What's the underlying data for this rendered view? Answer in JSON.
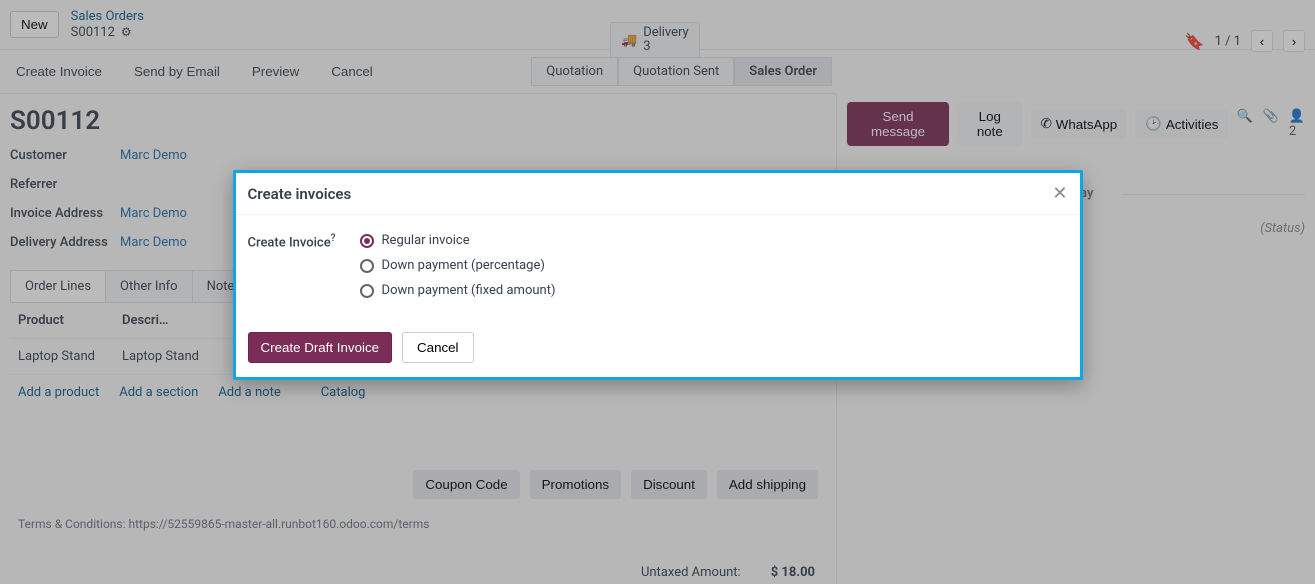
{
  "header": {
    "new_label": "New",
    "breadcrumb_parent": "Sales Orders",
    "breadcrumb_current": "S00112",
    "delivery_label": "Delivery",
    "delivery_count": "3",
    "pager_text": "1 / 1"
  },
  "actions": {
    "create_invoice": "Create Invoice",
    "send_email": "Send by Email",
    "preview": "Preview",
    "cancel": "Cancel"
  },
  "status": {
    "quotation": "Quotation",
    "quotation_sent": "Quotation Sent",
    "sales_order": "Sales Order"
  },
  "doc": {
    "title": "S00112",
    "customer_label": "Customer",
    "customer_value": "Marc Demo",
    "referrer_label": "Referrer",
    "invoice_addr_label": "Invoice Address",
    "invoice_addr_value": "Marc Demo",
    "delivery_addr_label": "Delivery Address",
    "delivery_addr_value": "Marc Demo"
  },
  "tabs": {
    "order_lines": "Order Lines",
    "other_info": "Other Info",
    "notes": "Note"
  },
  "table": {
    "col_product": "Product",
    "col_description": "Descri…",
    "row_product": "Laptop Stand",
    "row_desc": "Laptop Stand"
  },
  "adders": {
    "add_product": "Add a product",
    "add_section": "Add a section",
    "add_note": "Add a note",
    "catalog": "Catalog"
  },
  "totals": {
    "coupon": "Coupon Code",
    "promotions": "Promotions",
    "discount": "Discount",
    "add_shipping": "Add shipping",
    "untaxed_label": "Untaxed Amount:",
    "untaxed_value": "$ 18.00"
  },
  "terms": "Terms & Conditions: https://52559865-master-all.runbot160.odoo.com/terms",
  "chat": {
    "send_message": "Send message",
    "log_note": "Log note",
    "whatsapp": "WhatsApp",
    "activities": "Activities",
    "followers": "2",
    "today": "Today",
    "status_hint": "(Status)"
  },
  "modal": {
    "title": "Create invoices",
    "field_label": "Create Invoice",
    "field_help": "?",
    "opt_regular": "Regular invoice",
    "opt_down_pct": "Down payment (percentage)",
    "opt_down_fixed": "Down payment (fixed amount)",
    "create_btn": "Create Draft Invoice",
    "cancel_btn": "Cancel"
  }
}
